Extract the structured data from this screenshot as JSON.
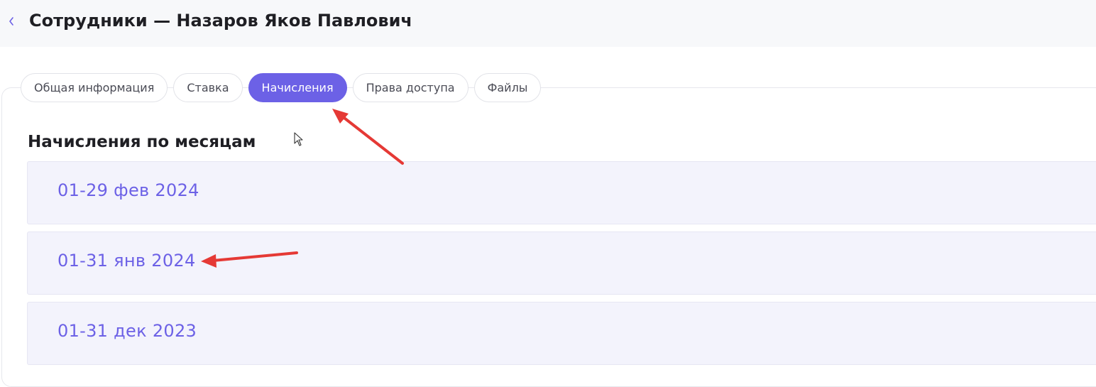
{
  "header": {
    "back_icon": "chevron-left-icon",
    "title": "Сотрудники — Назаров Яков Павлович"
  },
  "tabs": [
    {
      "label": "Общая информация",
      "active": false
    },
    {
      "label": "Ставка",
      "active": false
    },
    {
      "label": "Начисления",
      "active": true
    },
    {
      "label": "Права доступа",
      "active": false
    },
    {
      "label": "Файлы",
      "active": false
    }
  ],
  "section": {
    "title": "Начисления по месяцам"
  },
  "months": [
    {
      "label": "01-29 фев 2024"
    },
    {
      "label": "01-31 янв 2024"
    },
    {
      "label": "01-31 дек 2023"
    }
  ],
  "colors": {
    "accent": "#6c61e6",
    "row_background": "#f3f3fc",
    "annotation_arrow": "#e53935"
  }
}
